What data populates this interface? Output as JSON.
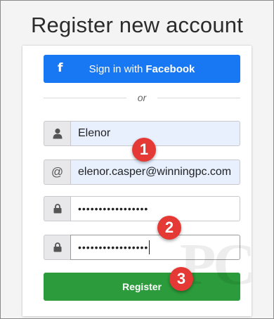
{
  "page": {
    "title": "Register new account"
  },
  "facebook_button": {
    "prefix": "Sign in with",
    "brand": "Facebook",
    "icon": "f"
  },
  "divider": {
    "text": "or"
  },
  "fields": {
    "username": {
      "value": "Elenor",
      "icon": "user-icon"
    },
    "email": {
      "value": "elenor.casper@winningpc.com",
      "icon": "at-sign-icon",
      "glyph": "@"
    },
    "password": {
      "value": "•••••••••••••••••",
      "icon": "lock-icon"
    },
    "confirm_password": {
      "value": "•••••••••••••••••",
      "icon": "lock-icon"
    }
  },
  "register_button": {
    "label": "Register",
    "color": "#2b9b3b"
  },
  "annotations": [
    {
      "label": "1",
      "color": "#e53935"
    },
    {
      "label": "2",
      "color": "#e53935"
    },
    {
      "label": "3",
      "color": "#e53935"
    }
  ],
  "watermark": {
    "text": "PC"
  },
  "colors": {
    "facebook": "#1877f2",
    "autofill": "#e8f0fe"
  }
}
